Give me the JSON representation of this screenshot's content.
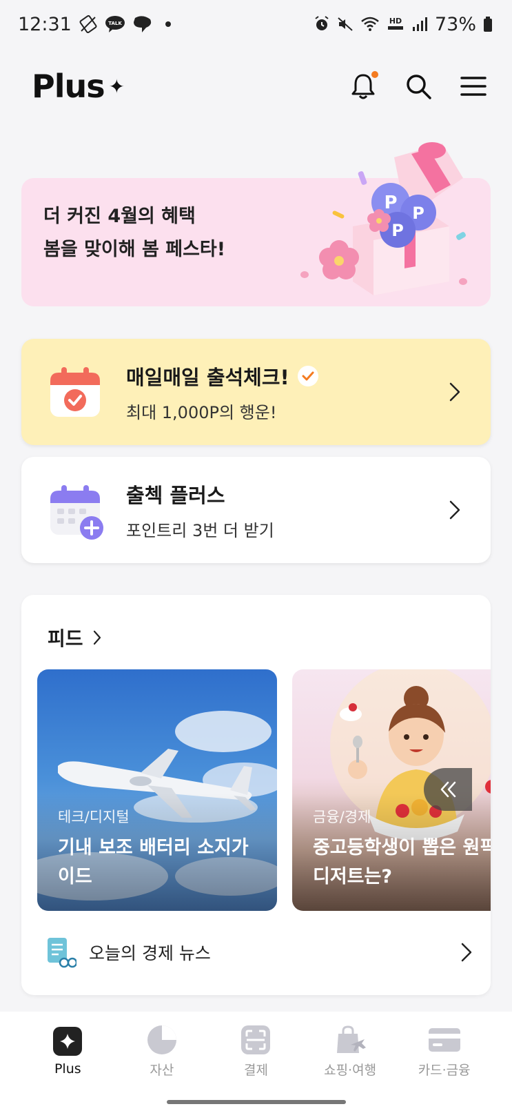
{
  "status_bar": {
    "time": "12:31",
    "battery": "73%",
    "talk_label": "TALK",
    "hd_label": "HD"
  },
  "header": {
    "logo": "Plus",
    "logo_mark": "✦"
  },
  "promo": {
    "line1": "더 커진 4월의 혜택",
    "line2": "봄을 맞이해 봄 페스타!",
    "coin_letter": "P"
  },
  "attendance_card": {
    "title": "매일매일 출석체크!",
    "subtitle": "최대 1,000P의 행운!"
  },
  "attendance_plus_card": {
    "title": "출첵 플러스",
    "subtitle": "포인트리 3번 더 받기"
  },
  "feed": {
    "title": "피드",
    "cards": [
      {
        "category": "테크/디지털",
        "title": "기내 보조 배터리 소지가이드"
      },
      {
        "category": "금융/경제",
        "title": "중고등학생이 뽑은 원픽 디저트는?"
      }
    ],
    "news_label": "오늘의 경제 뉴스"
  },
  "bottom_nav": {
    "items": [
      {
        "label": "Plus",
        "active": true
      },
      {
        "label": "자산",
        "active": false
      },
      {
        "label": "결제",
        "active": false
      },
      {
        "label": "쇼핑·여행",
        "active": false
      },
      {
        "label": "카드·금융",
        "active": false
      }
    ]
  },
  "colors": {
    "promo_bg": "#fce0ee",
    "attendance_bg": "#fef0b8",
    "accent_orange": "#f47b20",
    "calendar_red": "#f26b5b",
    "calendar_purple": "#8b7cf0"
  }
}
